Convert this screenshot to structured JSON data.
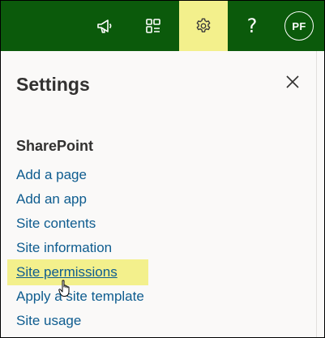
{
  "topbar": {
    "items": [
      {
        "name": "megaphone-icon"
      },
      {
        "name": "app-tiles-icon"
      },
      {
        "name": "gear-icon"
      },
      {
        "name": "help-icon",
        "glyph": "?"
      }
    ],
    "avatar_initials": "PF",
    "colors": {
      "bar": "#0b5a0b",
      "active": "#f3f08c"
    }
  },
  "panel": {
    "title": "Settings",
    "close_icon": "close-icon",
    "section_title": "SharePoint",
    "links": [
      "Add a page",
      "Add an app",
      "Site contents",
      "Site information",
      "Site permissions",
      "Apply a site template",
      "Site usage"
    ],
    "highlighted_link": "Site permissions",
    "link_color": "#0e5c8f"
  }
}
